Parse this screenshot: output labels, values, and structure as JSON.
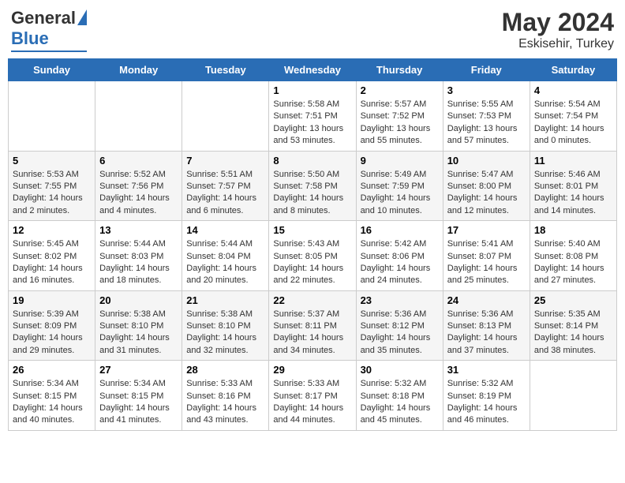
{
  "logo": {
    "general": "General",
    "blue": "Blue"
  },
  "header": {
    "month_year": "May 2024",
    "location": "Eskisehir, Turkey"
  },
  "weekdays": [
    "Sunday",
    "Monday",
    "Tuesday",
    "Wednesday",
    "Thursday",
    "Friday",
    "Saturday"
  ],
  "weeks": [
    [
      {
        "day": "",
        "info": ""
      },
      {
        "day": "",
        "info": ""
      },
      {
        "day": "",
        "info": ""
      },
      {
        "day": "1",
        "sunrise": "Sunrise: 5:58 AM",
        "sunset": "Sunset: 7:51 PM",
        "daylight": "Daylight: 13 hours and 53 minutes."
      },
      {
        "day": "2",
        "sunrise": "Sunrise: 5:57 AM",
        "sunset": "Sunset: 7:52 PM",
        "daylight": "Daylight: 13 hours and 55 minutes."
      },
      {
        "day": "3",
        "sunrise": "Sunrise: 5:55 AM",
        "sunset": "Sunset: 7:53 PM",
        "daylight": "Daylight: 13 hours and 57 minutes."
      },
      {
        "day": "4",
        "sunrise": "Sunrise: 5:54 AM",
        "sunset": "Sunset: 7:54 PM",
        "daylight": "Daylight: 14 hours and 0 minutes."
      }
    ],
    [
      {
        "day": "5",
        "sunrise": "Sunrise: 5:53 AM",
        "sunset": "Sunset: 7:55 PM",
        "daylight": "Daylight: 14 hours and 2 minutes."
      },
      {
        "day": "6",
        "sunrise": "Sunrise: 5:52 AM",
        "sunset": "Sunset: 7:56 PM",
        "daylight": "Daylight: 14 hours and 4 minutes."
      },
      {
        "day": "7",
        "sunrise": "Sunrise: 5:51 AM",
        "sunset": "Sunset: 7:57 PM",
        "daylight": "Daylight: 14 hours and 6 minutes."
      },
      {
        "day": "8",
        "sunrise": "Sunrise: 5:50 AM",
        "sunset": "Sunset: 7:58 PM",
        "daylight": "Daylight: 14 hours and 8 minutes."
      },
      {
        "day": "9",
        "sunrise": "Sunrise: 5:49 AM",
        "sunset": "Sunset: 7:59 PM",
        "daylight": "Daylight: 14 hours and 10 minutes."
      },
      {
        "day": "10",
        "sunrise": "Sunrise: 5:47 AM",
        "sunset": "Sunset: 8:00 PM",
        "daylight": "Daylight: 14 hours and 12 minutes."
      },
      {
        "day": "11",
        "sunrise": "Sunrise: 5:46 AM",
        "sunset": "Sunset: 8:01 PM",
        "daylight": "Daylight: 14 hours and 14 minutes."
      }
    ],
    [
      {
        "day": "12",
        "sunrise": "Sunrise: 5:45 AM",
        "sunset": "Sunset: 8:02 PM",
        "daylight": "Daylight: 14 hours and 16 minutes."
      },
      {
        "day": "13",
        "sunrise": "Sunrise: 5:44 AM",
        "sunset": "Sunset: 8:03 PM",
        "daylight": "Daylight: 14 hours and 18 minutes."
      },
      {
        "day": "14",
        "sunrise": "Sunrise: 5:44 AM",
        "sunset": "Sunset: 8:04 PM",
        "daylight": "Daylight: 14 hours and 20 minutes."
      },
      {
        "day": "15",
        "sunrise": "Sunrise: 5:43 AM",
        "sunset": "Sunset: 8:05 PM",
        "daylight": "Daylight: 14 hours and 22 minutes."
      },
      {
        "day": "16",
        "sunrise": "Sunrise: 5:42 AM",
        "sunset": "Sunset: 8:06 PM",
        "daylight": "Daylight: 14 hours and 24 minutes."
      },
      {
        "day": "17",
        "sunrise": "Sunrise: 5:41 AM",
        "sunset": "Sunset: 8:07 PM",
        "daylight": "Daylight: 14 hours and 25 minutes."
      },
      {
        "day": "18",
        "sunrise": "Sunrise: 5:40 AM",
        "sunset": "Sunset: 8:08 PM",
        "daylight": "Daylight: 14 hours and 27 minutes."
      }
    ],
    [
      {
        "day": "19",
        "sunrise": "Sunrise: 5:39 AM",
        "sunset": "Sunset: 8:09 PM",
        "daylight": "Daylight: 14 hours and 29 minutes."
      },
      {
        "day": "20",
        "sunrise": "Sunrise: 5:38 AM",
        "sunset": "Sunset: 8:10 PM",
        "daylight": "Daylight: 14 hours and 31 minutes."
      },
      {
        "day": "21",
        "sunrise": "Sunrise: 5:38 AM",
        "sunset": "Sunset: 8:10 PM",
        "daylight": "Daylight: 14 hours and 32 minutes."
      },
      {
        "day": "22",
        "sunrise": "Sunrise: 5:37 AM",
        "sunset": "Sunset: 8:11 PM",
        "daylight": "Daylight: 14 hours and 34 minutes."
      },
      {
        "day": "23",
        "sunrise": "Sunrise: 5:36 AM",
        "sunset": "Sunset: 8:12 PM",
        "daylight": "Daylight: 14 hours and 35 minutes."
      },
      {
        "day": "24",
        "sunrise": "Sunrise: 5:36 AM",
        "sunset": "Sunset: 8:13 PM",
        "daylight": "Daylight: 14 hours and 37 minutes."
      },
      {
        "day": "25",
        "sunrise": "Sunrise: 5:35 AM",
        "sunset": "Sunset: 8:14 PM",
        "daylight": "Daylight: 14 hours and 38 minutes."
      }
    ],
    [
      {
        "day": "26",
        "sunrise": "Sunrise: 5:34 AM",
        "sunset": "Sunset: 8:15 PM",
        "daylight": "Daylight: 14 hours and 40 minutes."
      },
      {
        "day": "27",
        "sunrise": "Sunrise: 5:34 AM",
        "sunset": "Sunset: 8:15 PM",
        "daylight": "Daylight: 14 hours and 41 minutes."
      },
      {
        "day": "28",
        "sunrise": "Sunrise: 5:33 AM",
        "sunset": "Sunset: 8:16 PM",
        "daylight": "Daylight: 14 hours and 43 minutes."
      },
      {
        "day": "29",
        "sunrise": "Sunrise: 5:33 AM",
        "sunset": "Sunset: 8:17 PM",
        "daylight": "Daylight: 14 hours and 44 minutes."
      },
      {
        "day": "30",
        "sunrise": "Sunrise: 5:32 AM",
        "sunset": "Sunset: 8:18 PM",
        "daylight": "Daylight: 14 hours and 45 minutes."
      },
      {
        "day": "31",
        "sunrise": "Sunrise: 5:32 AM",
        "sunset": "Sunset: 8:19 PM",
        "daylight": "Daylight: 14 hours and 46 minutes."
      },
      {
        "day": "",
        "info": ""
      }
    ]
  ]
}
